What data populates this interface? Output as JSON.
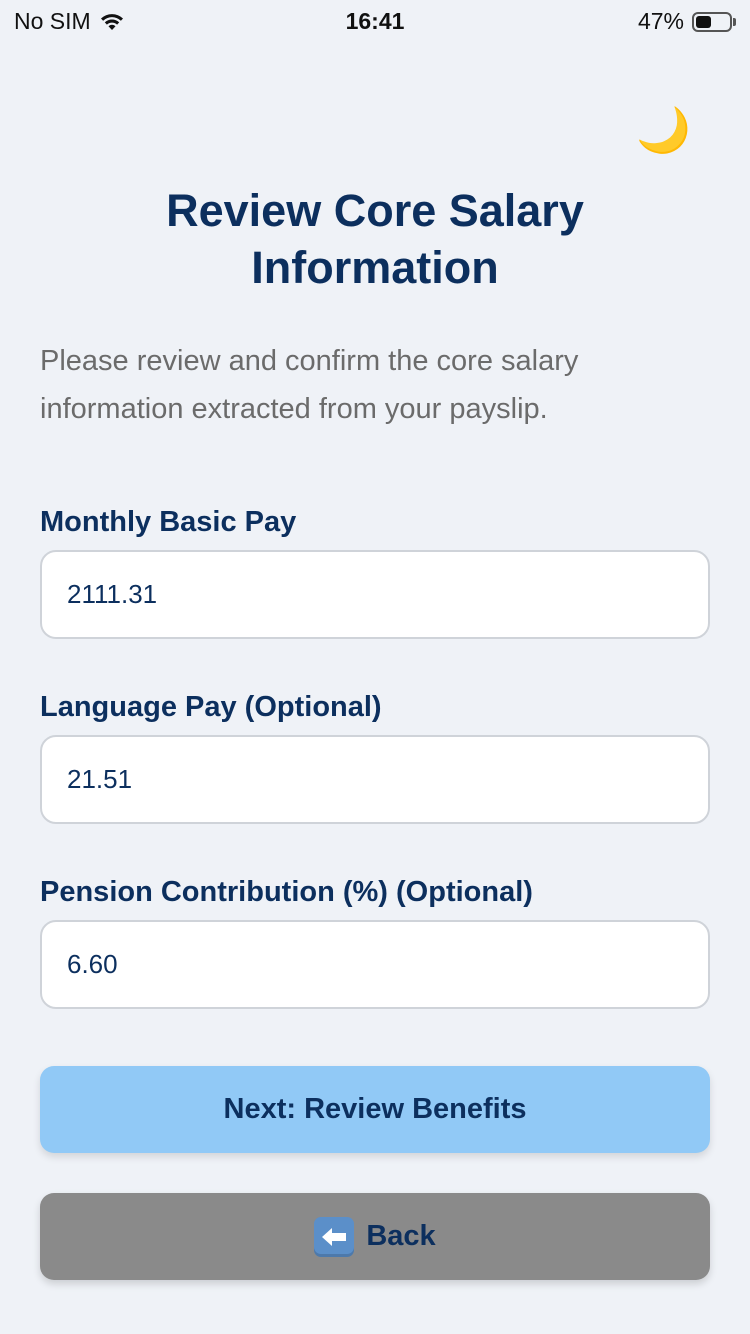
{
  "status_bar": {
    "carrier": "No SIM",
    "time": "16:41",
    "battery_percent": "47%",
    "battery_level": 0.47
  },
  "theme_toggle": {
    "icon": "crescent-moon-icon",
    "glyph": "🌙"
  },
  "page": {
    "title": "Review Core Salary Information",
    "description": "Please review and confirm the core salary information extracted from your payslip."
  },
  "fields": [
    {
      "label": "Monthly Basic Pay",
      "value": "2111.31"
    },
    {
      "label": "Language Pay (Optional)",
      "value": "21.51"
    },
    {
      "label": "Pension Contribution (%) (Optional)",
      "value": "6.60"
    }
  ],
  "buttons": {
    "next_label": "Next: Review Benefits",
    "back_label": "Back",
    "back_icon": "back-arrow-icon"
  },
  "colors": {
    "background": "#eff2f7",
    "heading": "#0c2f5e",
    "next_button": "#91c9f6",
    "back_button": "#8a8a8a"
  }
}
